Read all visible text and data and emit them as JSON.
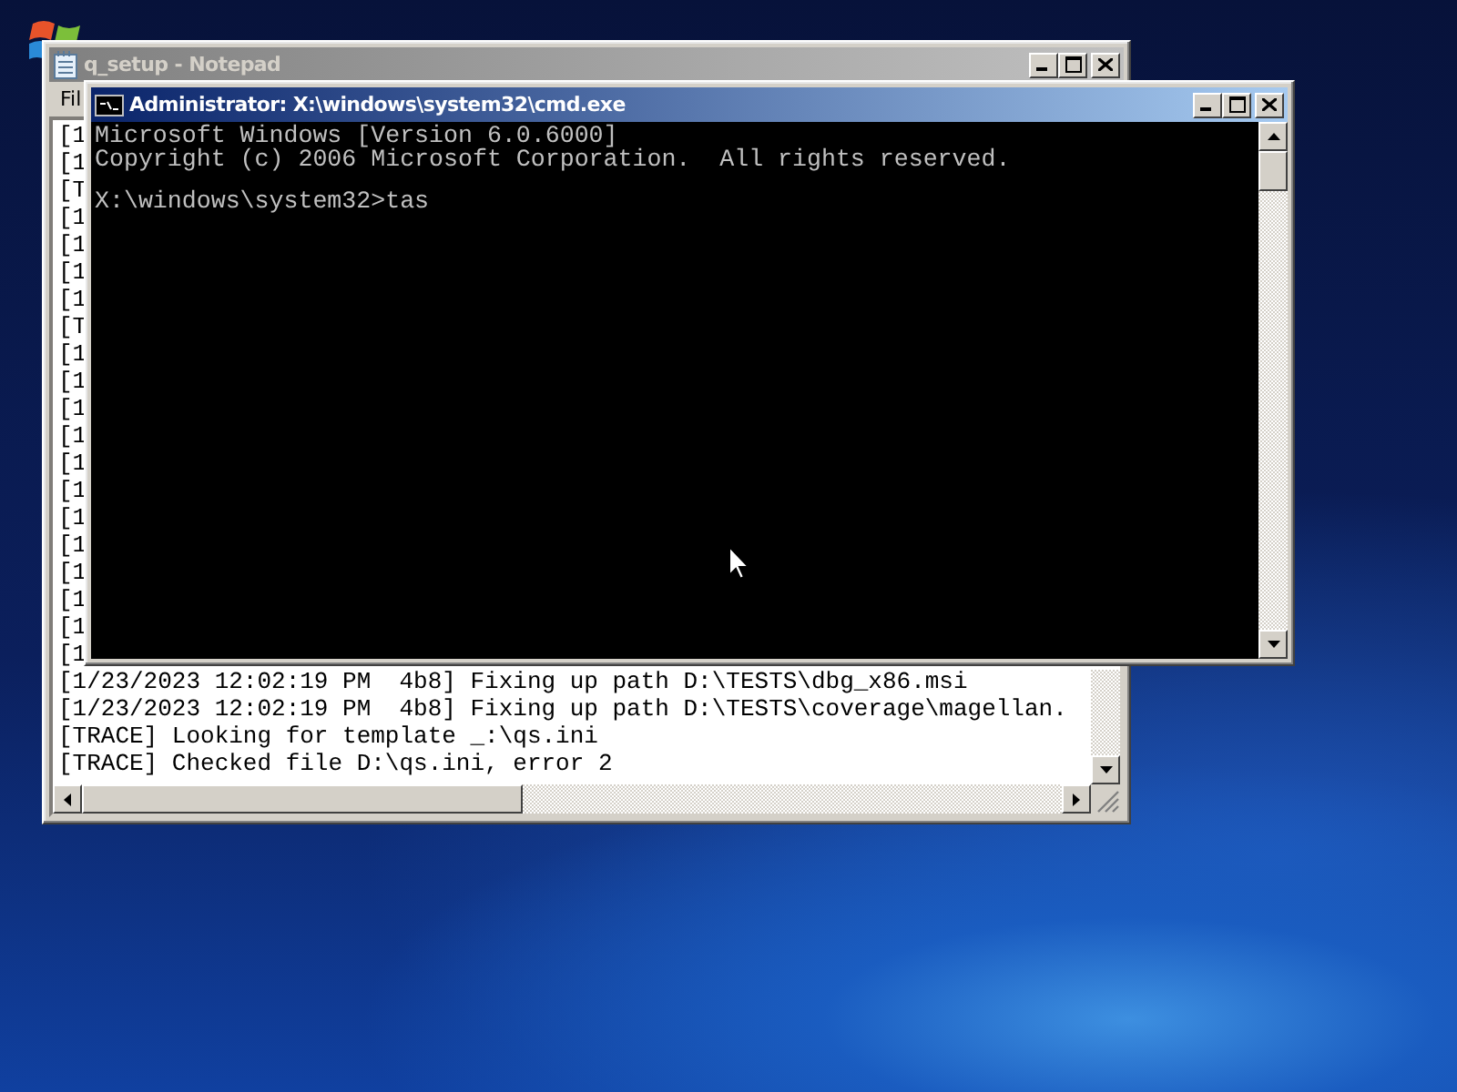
{
  "notepad": {
    "title": "q_setup - Notepad",
    "active": false,
    "menu": [
      "Fil"
    ],
    "lines": [
      "[1",
      "[1",
      "[T",
      "[1",
      "[1",
      "[1",
      "[1",
      "[T",
      "[1",
      "[1",
      "[1",
      "[1",
      "[1",
      "[1",
      "[1",
      "[1",
      "[1",
      "[1",
      "[1",
      "[1",
      "[1/23/2023 12:02:19 PM  4b8] Fixing up path D:\\TESTS\\dbg_x86.msi",
      "[1/23/2023 12:02:19 PM  4b8] Fixing up path D:\\TESTS\\coverage\\magellan.",
      "[TRACE] Looking for template _:\\qs.ini",
      "[TRACE] Checked file D:\\qs.ini, error 2"
    ]
  },
  "cmd": {
    "title": "Administrator: X:\\windows\\system32\\cmd.exe",
    "active": true,
    "lines": [
      {
        "kind": "output",
        "text": "Microsoft Windows [Version 6.0.6000]"
      },
      {
        "kind": "output",
        "text": "Copyright (c) 2006 Microsoft Corporation.  All rights reserved."
      },
      {
        "kind": "prompt",
        "text": "X:\\windows\\system32>tas"
      }
    ]
  }
}
